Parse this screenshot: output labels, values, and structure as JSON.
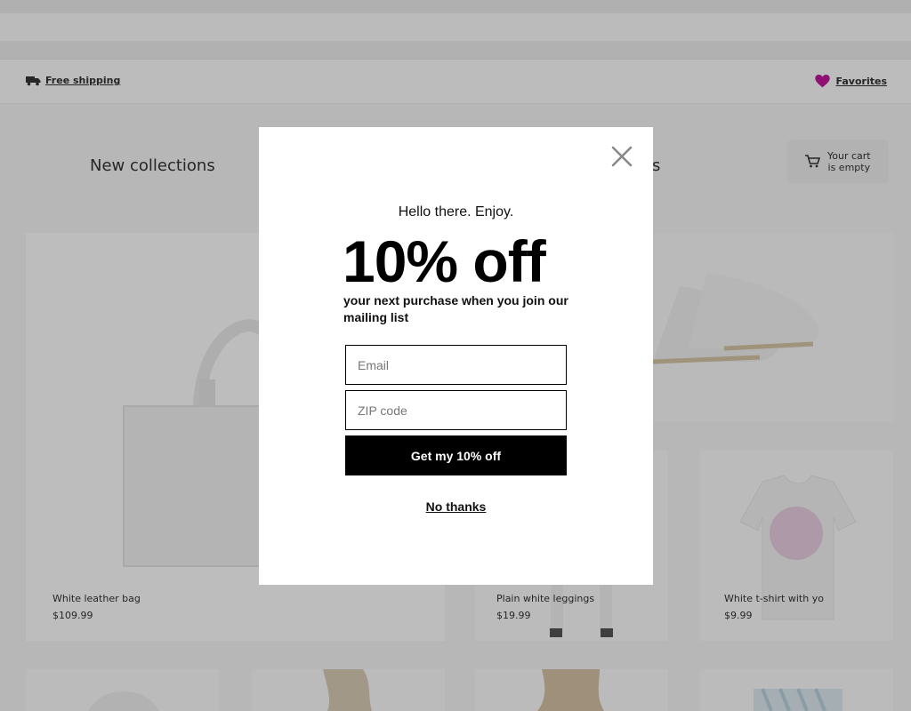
{
  "infobar": {
    "shipping_label": "Free shipping",
    "favorites_label": "Favorites"
  },
  "header": {
    "new_collections": "New collections",
    "second_title_fragment": "s",
    "cart_label_line1": "Your cart",
    "cart_label_line2": "is empty"
  },
  "products": [
    {
      "name": "White leather bag",
      "price": "$109.99"
    },
    {
      "name": "Plain white leggings",
      "price": "$19.99"
    },
    {
      "name": "White t-shirt with yo",
      "price": "$9.99"
    }
  ],
  "modal": {
    "greeting": "Hello there. Enjoy.",
    "headline": "10% off",
    "subline": "your next purchase when you join our mailing list",
    "email_placeholder": "Email",
    "zip_placeholder": "ZIP code",
    "submit_label": "Get my 10% off",
    "decline_label": "No thanks"
  },
  "colors": {
    "heart": "#c0169a",
    "cta_bg": "#000000",
    "overlay": "rgba(0,0,0,0.25)"
  },
  "icons": {
    "truck": "truck-icon",
    "heart": "heart-icon",
    "cart": "cart-icon",
    "close": "close-icon"
  }
}
